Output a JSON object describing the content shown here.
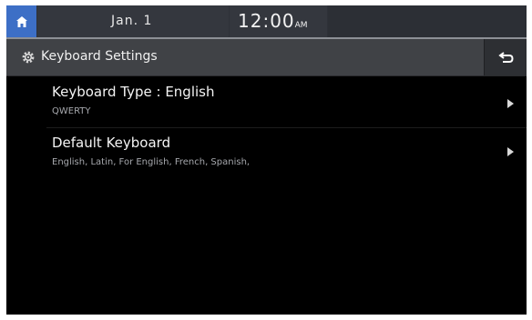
{
  "status": {
    "date": "Jan. 1",
    "time": "12:00",
    "ampm": "AM"
  },
  "header": {
    "title": "Keyboard Settings",
    "title_icon": "gear-icon",
    "back_icon": "back-arrow-icon"
  },
  "settings": [
    {
      "title": "Keyboard Type : English",
      "subtitle": "QWERTY"
    },
    {
      "title": "Default Keyboard",
      "subtitle": "English, Latin, For English, French, Spanish,"
    }
  ],
  "colors": {
    "home_button": "#3d6fc6",
    "status_bar": "#2e3138",
    "title_bar": "#404246",
    "background": "#000000"
  }
}
